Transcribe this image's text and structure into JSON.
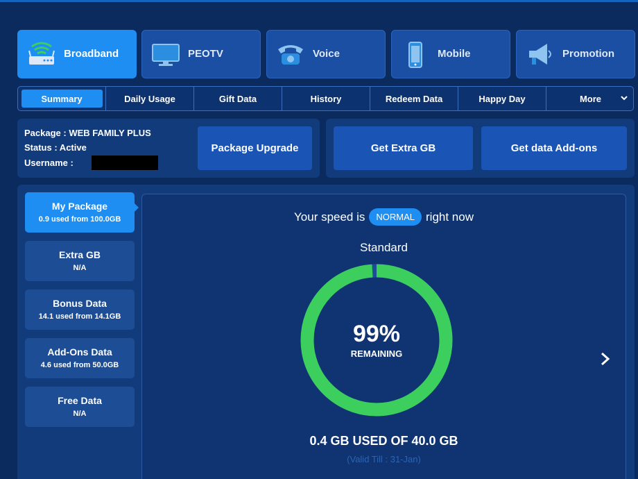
{
  "service_tabs": [
    {
      "label": "Broadband",
      "icon": "wifi-router-icon"
    },
    {
      "label": "PEOTV",
      "icon": "tv-icon"
    },
    {
      "label": "Voice",
      "icon": "telephone-icon"
    },
    {
      "label": "Mobile",
      "icon": "mobile-phone-icon"
    },
    {
      "label": "Promotion",
      "icon": "megaphone-icon"
    }
  ],
  "sub_tabs": [
    "Summary",
    "Daily Usage",
    "Gift Data",
    "History",
    "Redeem Data",
    "Happy Day",
    "More"
  ],
  "package_info": {
    "package": "Package : WEB FAMILY PLUS",
    "status": "Status : Active",
    "username_label": "Username :"
  },
  "buttons": {
    "package_upgrade": "Package Upgrade",
    "get_extra_gb": "Get Extra GB",
    "get_addons": "Get data Add-ons"
  },
  "side_menu": [
    {
      "title": "My Package",
      "sub": "0.9 used from 100.0GB"
    },
    {
      "title": "Extra GB",
      "sub": "N/A"
    },
    {
      "title": "Bonus Data",
      "sub": "14.1 used from 14.1GB"
    },
    {
      "title": "Add-Ons Data",
      "sub": "4.6 used from 50.0GB"
    },
    {
      "title": "Free Data",
      "sub": "N/A"
    }
  ],
  "detail": {
    "speed_prefix": "Your speed is",
    "speed_status": "NORMAL",
    "speed_suffix": "right now",
    "plan_name": "Standard",
    "remaining_percent": "99%",
    "remaining_label": "REMAINING",
    "remaining_fraction": 0.99,
    "usage": "0.4 GB USED OF 40.0 GB",
    "valid_till": "(Valid Till : 31-Jan)"
  },
  "colors": {
    "background": "#0b2a5e",
    "accent": "#1e8ef2",
    "gauge": "#3ccf5e"
  }
}
